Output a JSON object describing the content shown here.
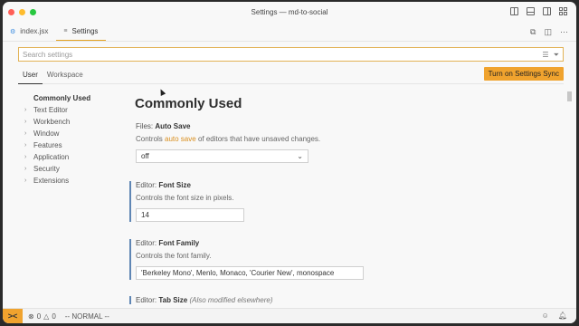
{
  "window": {
    "title": "Settings — md-to-social"
  },
  "colors": {
    "close": "#ff5f57",
    "minimize": "#febc2e",
    "maximize": "#28c840",
    "accent": "#f0a32e",
    "modified_marker": "#5f86b4"
  },
  "tabs": [
    {
      "label": "index.jsx",
      "icon": "gear-icon"
    },
    {
      "label": "Settings",
      "icon": "settings-file-icon",
      "active": true
    }
  ],
  "search": {
    "placeholder": "Search settings"
  },
  "scopes": {
    "user": "User",
    "workspace": "Workspace"
  },
  "sync_button": "Turn on Settings Sync",
  "toc": {
    "active": "Commonly Used",
    "items": [
      "Text Editor",
      "Workbench",
      "Window",
      "Features",
      "Application",
      "Security",
      "Extensions"
    ]
  },
  "section_title": "Commonly Used",
  "settings": {
    "autosave": {
      "category": "Files: ",
      "name": "Auto Save",
      "desc_before": "Controls ",
      "desc_link": "auto save",
      "desc_after": " of editors that have unsaved changes.",
      "value": "off"
    },
    "fontsize": {
      "category": "Editor: ",
      "name": "Font Size",
      "desc": "Controls the font size in pixels.",
      "value": "14"
    },
    "fontfamily": {
      "category": "Editor: ",
      "name": "Font Family",
      "desc": "Controls the font family.",
      "value": "'Berkeley Mono', Menlo, Monaco, 'Courier New', monospace"
    },
    "tabsize": {
      "category": "Editor: ",
      "name": "Tab Size",
      "note": "(Also modified elsewhere)"
    }
  },
  "status": {
    "remote_glyph": "><",
    "errors": "0",
    "warnings": "0",
    "mode": "-- NORMAL --"
  }
}
